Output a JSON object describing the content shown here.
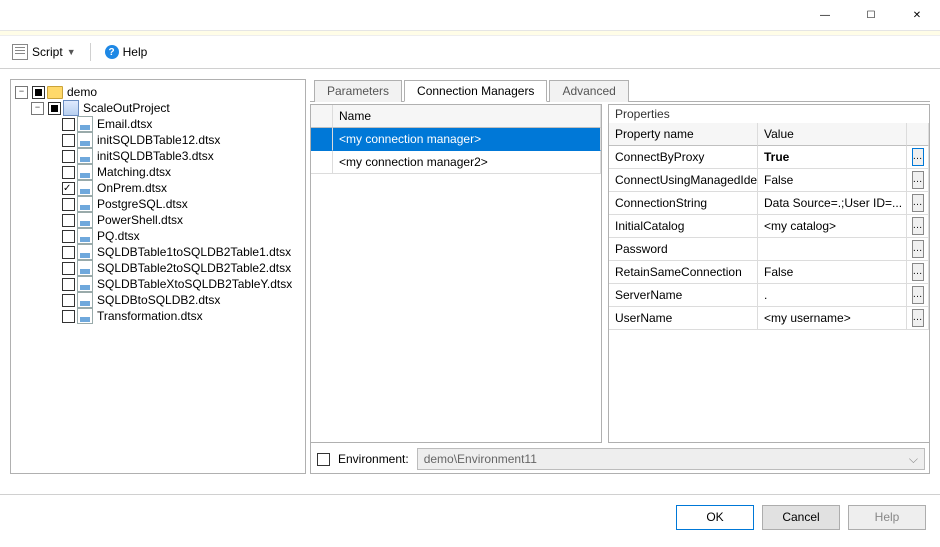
{
  "window": {
    "minimize": "—",
    "maximize": "☐",
    "close": "✕"
  },
  "toolbar": {
    "script_label": "Script",
    "help_label": "Help"
  },
  "tree": {
    "root_label": "demo",
    "project_label": "ScaleOutProject",
    "packages": [
      "Email.dtsx",
      "initSQLDBTable12.dtsx",
      "initSQLDBTable3.dtsx",
      "Matching.dtsx",
      "OnPrem.dtsx",
      "PostgreSQL.dtsx",
      "PowerShell.dtsx",
      "PQ.dtsx",
      "SQLDBTable1toSQLDB2Table1.dtsx",
      "SQLDBTable2toSQLDB2Table2.dtsx",
      "SQLDBTableXtoSQLDB2TableY.dtsx",
      "SQLDBtoSQLDB2.dtsx",
      "Transformation.dtsx"
    ],
    "checked_index": 4
  },
  "tabs": {
    "items": [
      "Parameters",
      "Connection Managers",
      "Advanced"
    ],
    "active_index": 1
  },
  "cm_grid": {
    "col_blank": "",
    "col_name": "Name",
    "rows": [
      "<my connection manager>",
      "<my connection manager2>"
    ],
    "selected_index": 0
  },
  "prop_grid": {
    "title": "Properties",
    "col_name": "Property name",
    "col_value": "Value",
    "rows": [
      {
        "name": "ConnectByProxy",
        "value": "True",
        "bold": true,
        "highlight": true
      },
      {
        "name": "ConnectUsingManagedIdentity",
        "value": "False"
      },
      {
        "name": "ConnectionString",
        "value": "Data Source=.;User ID=..."
      },
      {
        "name": "InitialCatalog",
        "value": "<my catalog>"
      },
      {
        "name": "Password",
        "value": ""
      },
      {
        "name": "RetainSameConnection",
        "value": "False"
      },
      {
        "name": "ServerName",
        "value": "."
      },
      {
        "name": "UserName",
        "value": "<my username>"
      }
    ]
  },
  "environment": {
    "label": "Environment:",
    "value": "demo\\Environment11"
  },
  "buttons": {
    "ok": "OK",
    "cancel": "Cancel",
    "help": "Help"
  }
}
